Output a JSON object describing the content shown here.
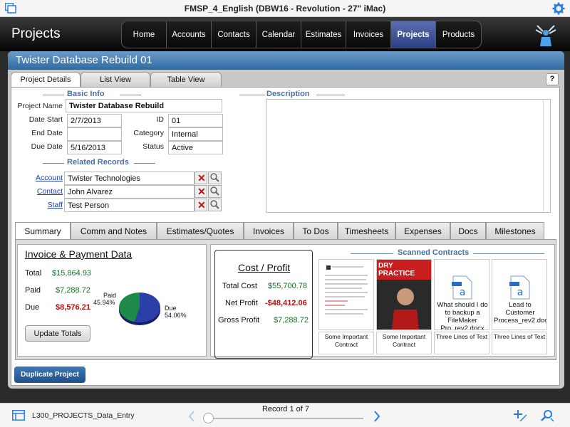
{
  "window": {
    "title": "FMSP_4_English (DBW16 - Revolution - 27\" iMac)"
  },
  "header": {
    "app_title": "Projects",
    "nav": [
      "Home",
      "Accounts",
      "Contacts",
      "Calendar",
      "Estimates",
      "Invoices",
      "Projects",
      "Products"
    ],
    "active_nav": "Projects"
  },
  "panel": {
    "title": "Twister Database Rebuild 01",
    "tabs": [
      "Project Details",
      "List View",
      "Table View"
    ],
    "help": "?"
  },
  "basic_info": {
    "heading": "Basic Info",
    "project_name_label": "Project Name",
    "project_name": "Twister Database Rebuild",
    "date_start_label": "Date Start",
    "date_start": "2/7/2013",
    "end_date_label": "End Date",
    "end_date": "",
    "due_date_label": "Due Date",
    "due_date": "5/16/2013",
    "id_label": "ID",
    "id": "01",
    "category_label": "Category",
    "category": "Internal",
    "status_label": "Status",
    "status": "Active"
  },
  "related": {
    "heading": "Related Records",
    "account_label": "Account",
    "account": "Twister Technologies",
    "contact_label": "Contact",
    "contact": "John Alvarez",
    "staff_label": "Staff",
    "staff": "Test Person"
  },
  "description": {
    "heading": "Description",
    "value": ""
  },
  "sub_tabs": [
    "Summary",
    "Comm and Notes",
    "Estimates/Quotes",
    "Invoices",
    "To Dos",
    "Timesheets",
    "Expenses",
    "Docs",
    "Milestones"
  ],
  "invoice": {
    "title": "Invoice & Payment Data",
    "total_label": "Total",
    "total": "$15,864.93",
    "paid_label": "Paid",
    "paid": "$7,288.72",
    "due_label": "Due",
    "due": "$8,576.21",
    "update_button": "Update Totals",
    "pie_paid_label": "Paid",
    "pie_paid_pct": "45.94%",
    "pie_due_label": "Due",
    "pie_due_pct": "54.06%",
    "pie_paid_value": 45.94,
    "pie_due_value": 54.06,
    "pie_paid_color": "#1e8a4a",
    "pie_due_color": "#2a3fa8"
  },
  "cost_profit": {
    "title": "Cost / Profit",
    "total_cost_label": "Total Cost",
    "total_cost": "$55,700.78",
    "net_profit_label": "Net Profit",
    "net_profit": "-$48,412.06",
    "gross_profit_label": "Gross Profit",
    "gross_profit": "$7,288.72"
  },
  "contracts": {
    "heading": "Scanned Contracts",
    "items": [
      {
        "caption": "Some Important Contract"
      },
      {
        "caption": "Some Important Contract",
        "thumb_heading": "DRY PRACTICE"
      },
      {
        "caption": "Three Lines of Text",
        "thumb_text": "What should I do to backup a FileMaker Pro_rev2.docx"
      },
      {
        "caption": "Three Lines of Text",
        "thumb_text": "Lead to Customer Process_rev2.docx"
      }
    ]
  },
  "actions": {
    "duplicate": "Duplicate Project"
  },
  "footer": {
    "layout_name": "L300_PROJECTS_Data_Entry",
    "record": "Record 1 of 7",
    "record_fraction": 0.0
  }
}
